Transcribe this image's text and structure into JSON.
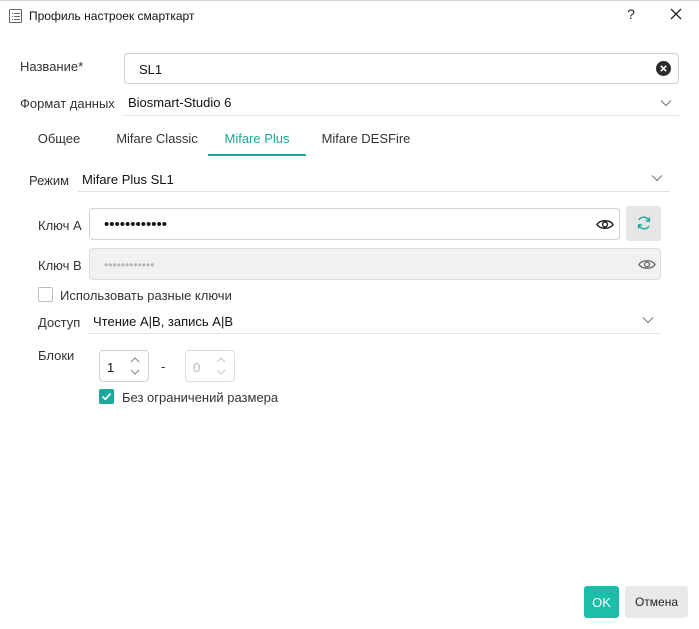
{
  "window": {
    "title": "Профиль настроек смарткарт",
    "help_label": "?",
    "title_icon": "list-icon",
    "close_icon": "close-icon"
  },
  "name_field": {
    "label": "Название*",
    "value": "SL1",
    "clear_icon": "clear-circle-icon"
  },
  "data_format": {
    "label": "Формат данных",
    "value": "Biosmart-Studio 6"
  },
  "tabs": [
    {
      "label": "Общее",
      "active": false
    },
    {
      "label": "Mifare Classic",
      "active": false
    },
    {
      "label": "Mifare Plus",
      "active": true
    },
    {
      "label": "Mifare DESFire",
      "active": false
    }
  ],
  "mode": {
    "label": "Режим",
    "value": "Mifare Plus SL1"
  },
  "key_a": {
    "label": "Ключ A",
    "masked_value": "••••••••••••",
    "eye_icon": "eye-icon",
    "refresh_icon": "refresh-icon"
  },
  "key_b": {
    "label": "Ключ B",
    "masked_value": "••••••••••••",
    "disabled": true,
    "eye_icon": "eye-icon"
  },
  "different_keys": {
    "label": "Использовать разные ключи",
    "checked": false
  },
  "access": {
    "label": "Доступ",
    "value": "Чтение A|B, запись A|B"
  },
  "blocks": {
    "label": "Блоки",
    "from": "1",
    "separator": "-",
    "to": "0",
    "to_disabled": true
  },
  "unlimited_size": {
    "label": "Без ограничений размера",
    "checked": true
  },
  "footer": {
    "ok_label": "OK",
    "cancel_label": "Отмена"
  },
  "colors": {
    "accent": "#1aa99a",
    "ok_button": "#1bbfa9",
    "cancel_button": "#e9e9e9"
  }
}
